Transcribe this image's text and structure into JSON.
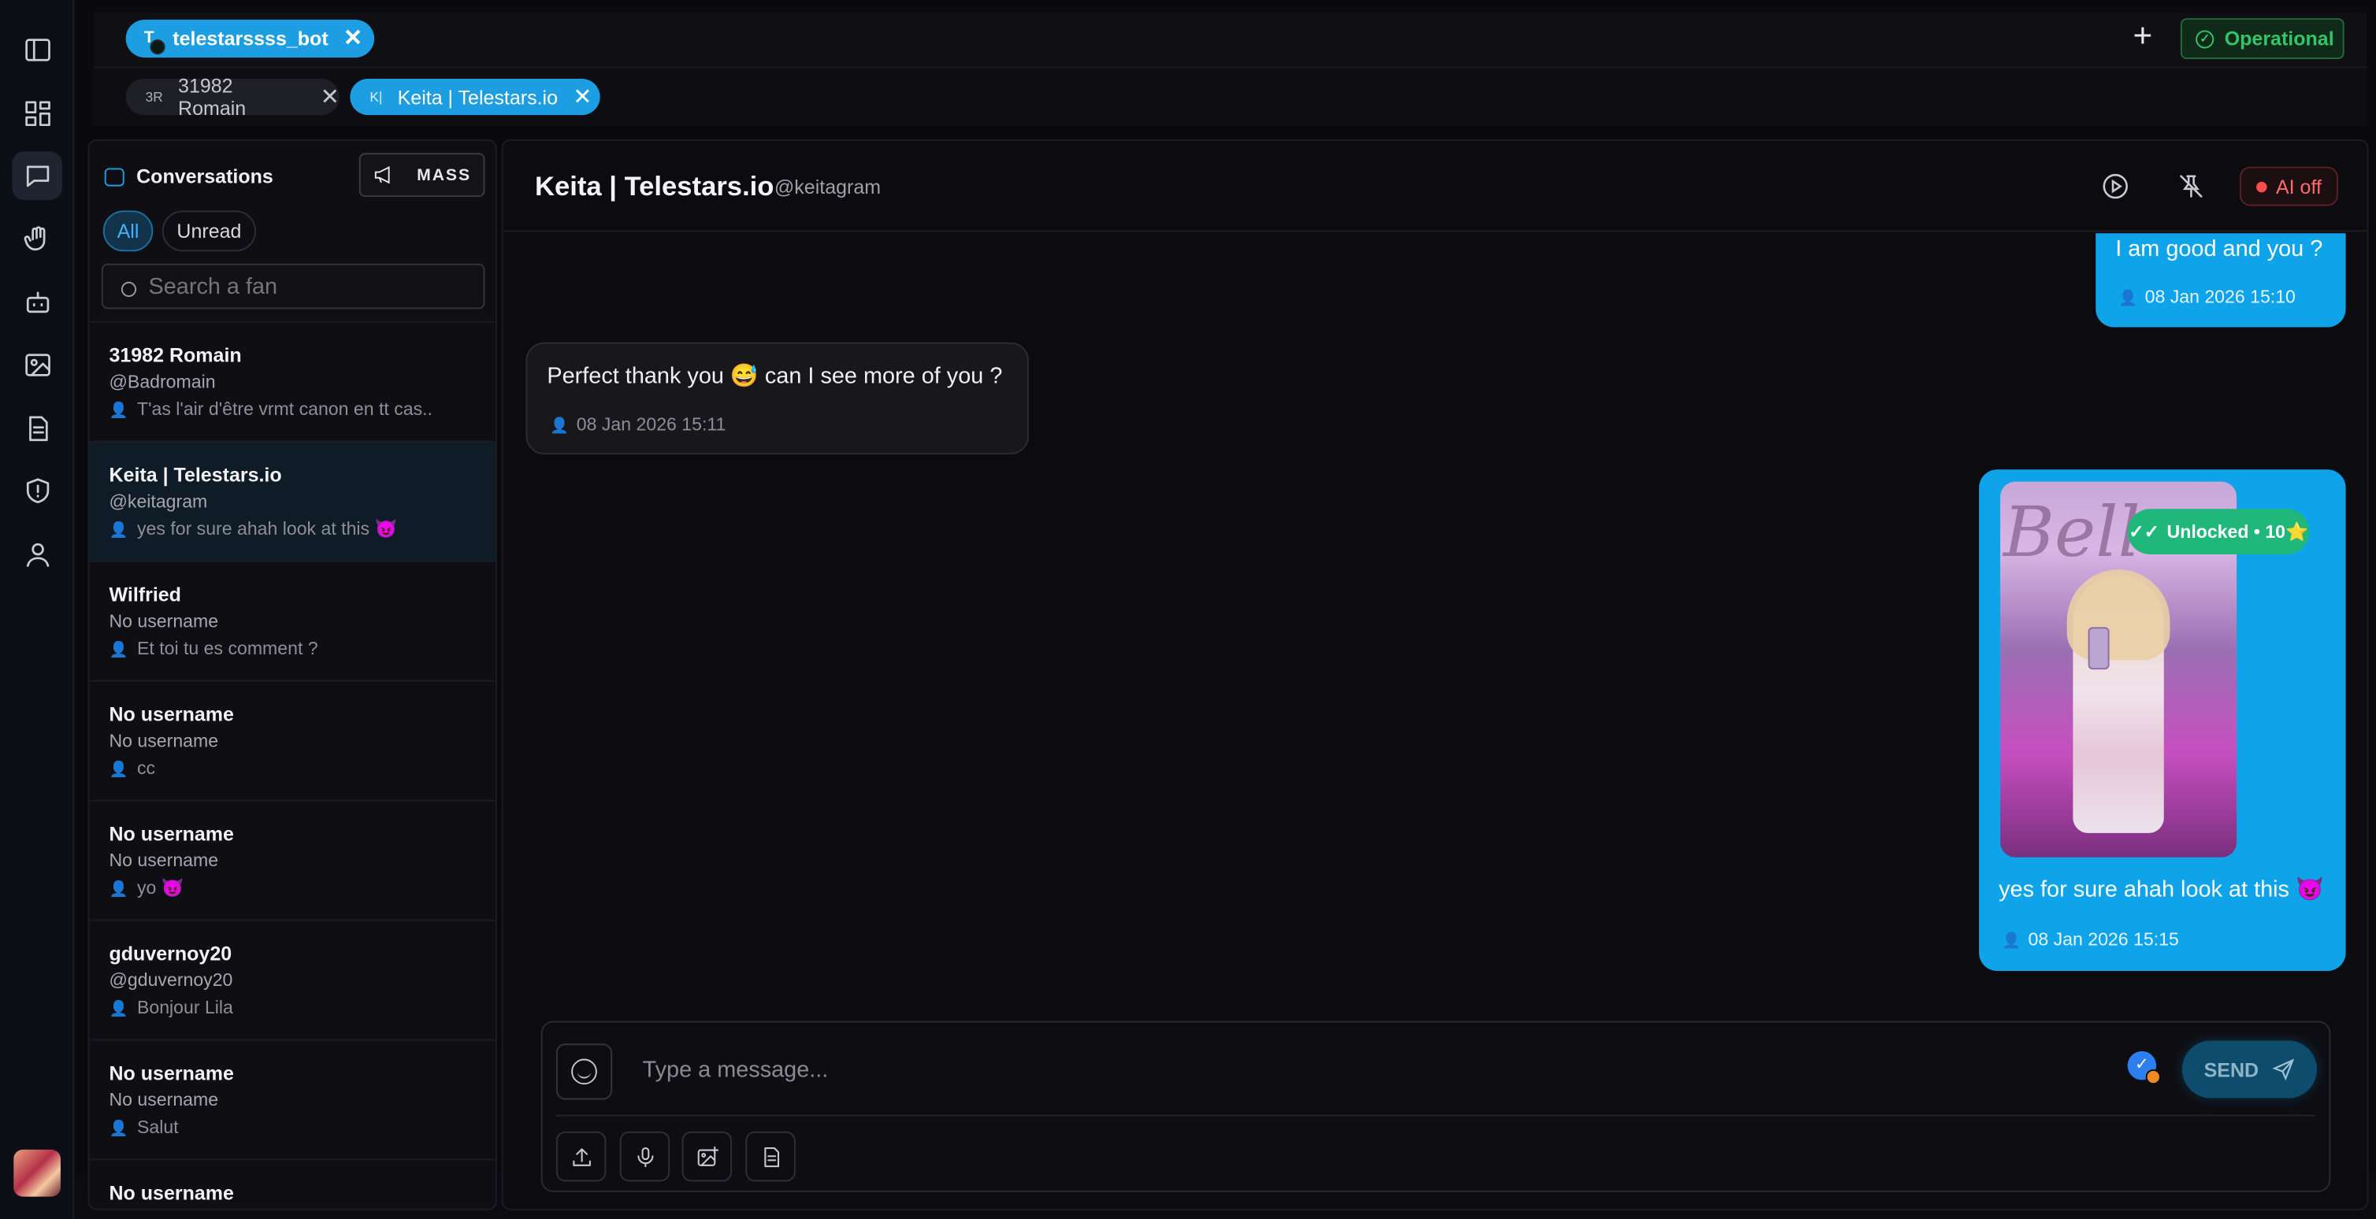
{
  "tabs": {
    "bot_tab": {
      "label": "telestarssss_bot",
      "icon": "T"
    },
    "chat_tabs": [
      {
        "initials": "3R",
        "label": "31982 Romain"
      },
      {
        "initials": "K|",
        "label": "Keita | Telestars.io"
      }
    ],
    "status_label": "Operational"
  },
  "sidebar": {
    "icons": [
      "sidebar-toggle-icon",
      "dashboard-icon",
      "chat-icon",
      "hand-icon",
      "bot-icon",
      "image-icon",
      "document-icon",
      "shield-icon",
      "user-icon"
    ],
    "active": "chat-icon"
  },
  "conversations": {
    "title": "Conversations",
    "mass_label": "MASS",
    "filters": {
      "all": "All",
      "unread": "Unread"
    },
    "search_placeholder": "Search a fan",
    "items": [
      {
        "name": "31982 Romain",
        "username": "@Badromain",
        "preview": "T'as l'air d'être vrmt canon en tt cas.."
      },
      {
        "name": "Keita | Telestars.io",
        "username": "@keitagram",
        "preview": "yes for sure ahah look at this 😈"
      },
      {
        "name": "Wilfried",
        "username": "No username",
        "preview": "Et toi tu es comment ?"
      },
      {
        "name": "No username",
        "username": "No username",
        "preview": "cc"
      },
      {
        "name": "No username",
        "username": "No username",
        "preview": "yo 😈"
      },
      {
        "name": "gduvernoy20",
        "username": "@gduvernoy20",
        "preview": "Bonjour Lila"
      },
      {
        "name": "No username",
        "username": "No username",
        "preview": "Salut"
      },
      {
        "name": "No username",
        "username": "",
        "preview": ""
      }
    ]
  },
  "chat": {
    "title": "Keita | Telestars.io",
    "handle": "@keitagram",
    "ai_status": "AI off",
    "messages": [
      {
        "direction": "out",
        "text": "I am good and you ?",
        "time": "08 Jan 2026 15:10"
      },
      {
        "direction": "in",
        "text": "Perfect thank you 😅 can I see more of you ?",
        "time": "08 Jan 2026 15:11"
      },
      {
        "direction": "out",
        "badge": "Unlocked • 10⭐",
        "text": "yes for sure ahah look at this 😈",
        "time": "08 Jan 2026 15:15"
      }
    ],
    "composer": {
      "placeholder": "Type a message...",
      "send_label": "SEND"
    }
  }
}
